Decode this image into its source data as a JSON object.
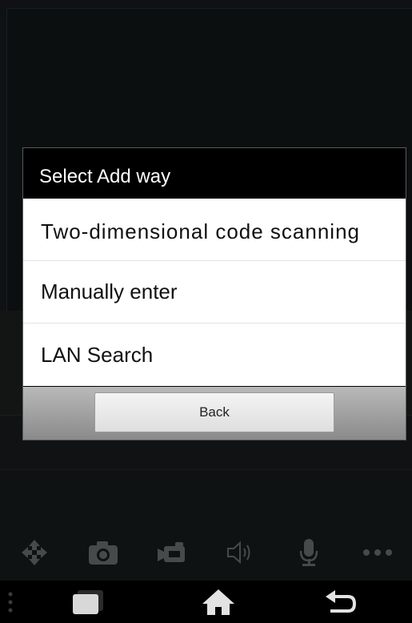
{
  "dialog": {
    "title": "Select Add way",
    "options": [
      {
        "label": "Two-dimensional code scanning"
      },
      {
        "label": "Manually enter"
      },
      {
        "label": "LAN Search"
      }
    ],
    "back_label": "Back"
  },
  "toolbar": {
    "icons": [
      "move-arrows-icon",
      "camera-icon",
      "video-camera-icon",
      "speaker-icon",
      "microphone-icon",
      "more-icon"
    ]
  },
  "navbar": {
    "icons": [
      "menu-dots-icon",
      "recent-apps-icon",
      "home-icon",
      "back-icon"
    ]
  },
  "colors": {
    "dialog_bg": "#000000",
    "option_bg": "#ffffff",
    "toolbar_icon": "#6c7072"
  }
}
